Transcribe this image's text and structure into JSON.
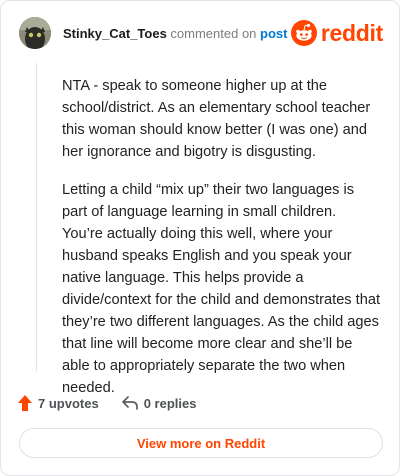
{
  "header": {
    "username": "Stinky_Cat_Toes",
    "commented_text": "commented on",
    "post_link": "post",
    "brand": "reddit"
  },
  "comment": {
    "paragraphs": [
      "NTA - speak to someone higher up at the school/district. As an elementary school teacher this woman should know better (I was one) and her ignorance and bigotry is disgusting.",
      "Letting a child “mix up” their two languages is part of language learning in small children. You’re actually doing this well, where your husband speaks English and you speak your native language. This helps provide a divide/context for the child and demonstrates that they’re two different languages. As the child ages that line will become more clear and she’ll be able to appropriately separate the two when needed."
    ]
  },
  "actions": {
    "upvotes": "7 upvotes",
    "replies": "0 replies"
  },
  "view_more": "View more on Reddit",
  "colors": {
    "brand": "#ff4500",
    "link": "#0079d3",
    "upvote": "#ff4500"
  },
  "icons": {
    "avatar": "user-avatar",
    "brand_logo": "reddit-snoo-icon",
    "upvote": "upvote-arrow-icon",
    "reply": "reply-arrow-icon"
  }
}
